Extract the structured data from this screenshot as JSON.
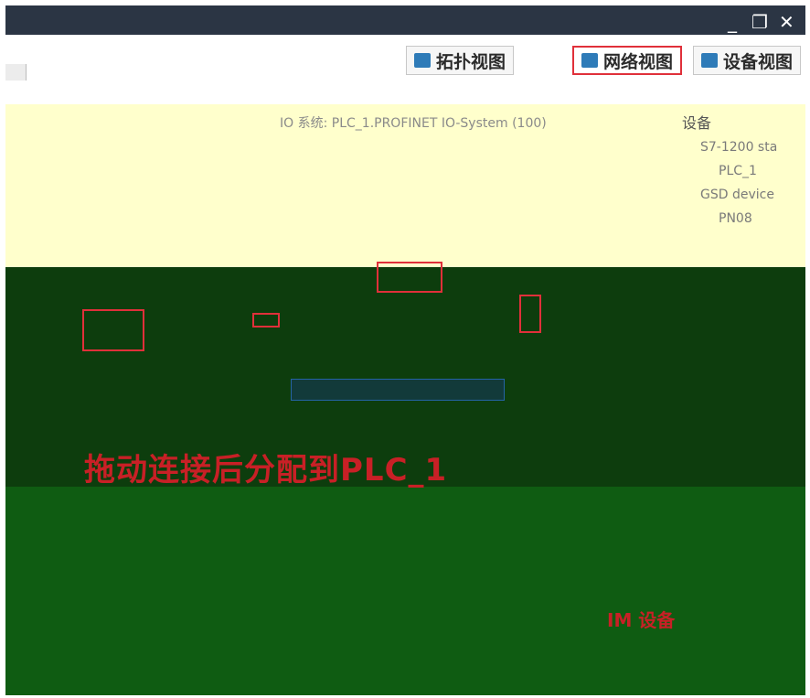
{
  "window": {
    "minimize_glyph": "_",
    "restore_glyph": "❐",
    "close_glyph": "✕"
  },
  "tabs": [
    {
      "label": "拓扑视图",
      "icon": "topology-view-icon",
      "active": false
    },
    {
      "label": "网络视图",
      "icon": "network-view-icon",
      "active": true
    },
    {
      "label": "设备视图",
      "icon": "device-view-icon",
      "active": false
    }
  ],
  "network": {
    "io_system_label": "IO 系统: PLC_1.PROFINET IO-System (100)"
  },
  "overview": {
    "title": "设备",
    "items": [
      {
        "label": "S7-1200 sta",
        "expanded": true
      },
      {
        "label": "PLC_1",
        "expanded": false
      },
      {
        "label": "GSD device",
        "expanded": true
      },
      {
        "label": "PN08",
        "expanded": false
      }
    ]
  },
  "annotations": {
    "caption": "拖动连接后分配到PLC_1",
    "note": "IM 设备"
  },
  "colors": {
    "highlight": "#e0303a",
    "titlebar": "#2b3544",
    "canvas_top": "#ffffcc",
    "canvas_dark": "#0d3d0d",
    "canvas_bottom": "#0f5c12"
  }
}
